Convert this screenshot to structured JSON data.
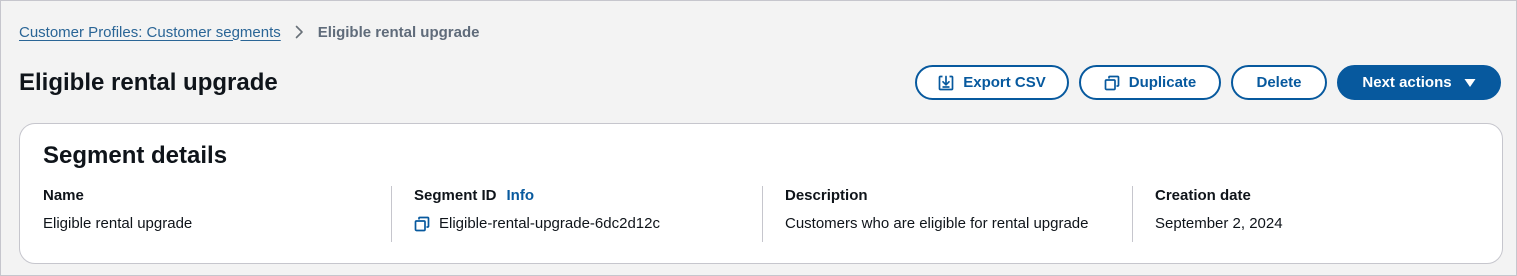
{
  "breadcrumb": {
    "parent": "Customer Profiles: Customer segments",
    "current": "Eligible rental upgrade"
  },
  "header": {
    "title": "Eligible rental upgrade"
  },
  "actions": {
    "export_label": "Export CSV",
    "duplicate_label": "Duplicate",
    "delete_label": "Delete",
    "next_label": "Next actions"
  },
  "details": {
    "title": "Segment details",
    "name_label": "Name",
    "name_value": "Eligible rental upgrade",
    "segment_id_label": "Segment ID",
    "info_label": "Info",
    "segment_id_value": "Eligible-rental-upgrade-6dc2d12c",
    "description_label": "Description",
    "description_value": "Customers who are eligible for rental upgrade",
    "creation_label": "Creation date",
    "creation_value": "September 2, 2024"
  },
  "icons": {
    "breadcrumb_separator": "chevron-right-icon",
    "export": "download-icon",
    "duplicate": "copy-icon",
    "next_actions": "caret-down-icon",
    "segment_id_copy": "copy-icon"
  },
  "colors": {
    "accent": "#07599e",
    "link": "#2a6596",
    "background": "#f3f3f3",
    "card": "#ffffff",
    "border": "#c6c6cd",
    "text": "#0f141a"
  }
}
